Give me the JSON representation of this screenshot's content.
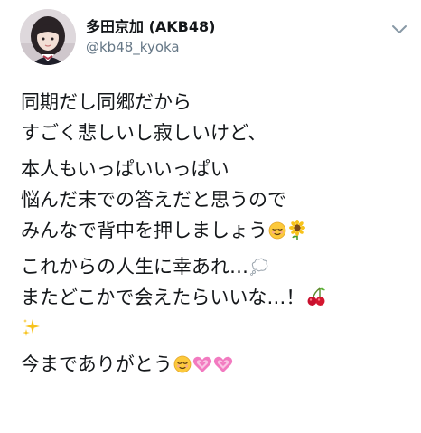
{
  "user": {
    "display_name": "多田京加 (AKB48)",
    "handle": "@kb48_kyoka"
  },
  "tweet": {
    "lines": [
      "同期だし同郷だから",
      "すごく悲しいし寂しいけど、",
      "本人もいっぱいいっぱい",
      "悩んだ末での答えだと思うので",
      "みんなで背中を押しましょう",
      "これからの人生に幸あれ…",
      "またどこかで会えたらいいな…！",
      "今までありがとう"
    ]
  },
  "icons": {
    "menu": "chevron-down-icon",
    "emojis": [
      "relieved-face-emoji",
      "sunflower-emoji",
      "thought-balloon-emoji",
      "cherries-emoji",
      "sparkles-emoji",
      "relieved-face-emoji",
      "growing-heart-emoji",
      "growing-heart-emoji"
    ]
  },
  "colors": {
    "text": "#14171a",
    "secondary": "#657786",
    "chevron": "#8899a6"
  }
}
